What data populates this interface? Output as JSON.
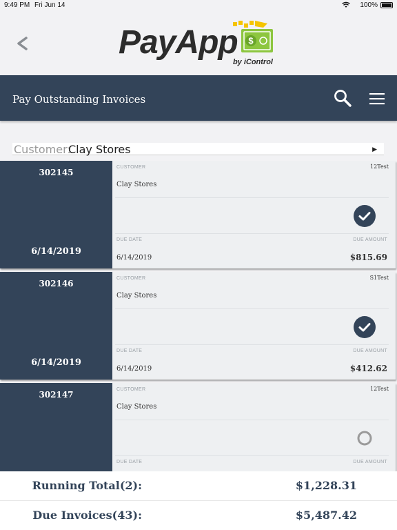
{
  "status_bar": {
    "time": "9:49 PM",
    "date": "Fri Jun 14",
    "battery": "100%"
  },
  "logo": {
    "name": "PayApp",
    "byline": "by iControl",
    "accent_green": "#8dc63f",
    "accent_yellow": "#f5c400"
  },
  "header": {
    "title": "Pay Outstanding Invoices",
    "background": "#334459"
  },
  "customer_select": {
    "label": "Customer:",
    "value": "Clay Stores"
  },
  "invoice_labels": {
    "customer": "CUSTOMER",
    "due_date": "DUE DATE",
    "due_amount": "DUE AMOUNT"
  },
  "invoices": [
    {
      "number": "302145",
      "date": "6/14/2019",
      "type": "12Test",
      "customer": "Clay Stores",
      "due_date": "6/14/2019",
      "amount": "$815.69",
      "selected": true
    },
    {
      "number": "302146",
      "date": "6/14/2019",
      "type": "S1Test",
      "customer": "Clay Stores",
      "due_date": "6/14/2019",
      "amount": "$412.62",
      "selected": true
    },
    {
      "number": "302147",
      "date": "",
      "type": "12Test",
      "customer": "Clay Stores",
      "due_date": "",
      "amount": "",
      "selected": false
    }
  ],
  "totals": {
    "running_label": "Running Total(2):",
    "running_value": "$1,228.31",
    "due_label": "Due Invoices(43):",
    "due_value": "$5,487.42"
  }
}
